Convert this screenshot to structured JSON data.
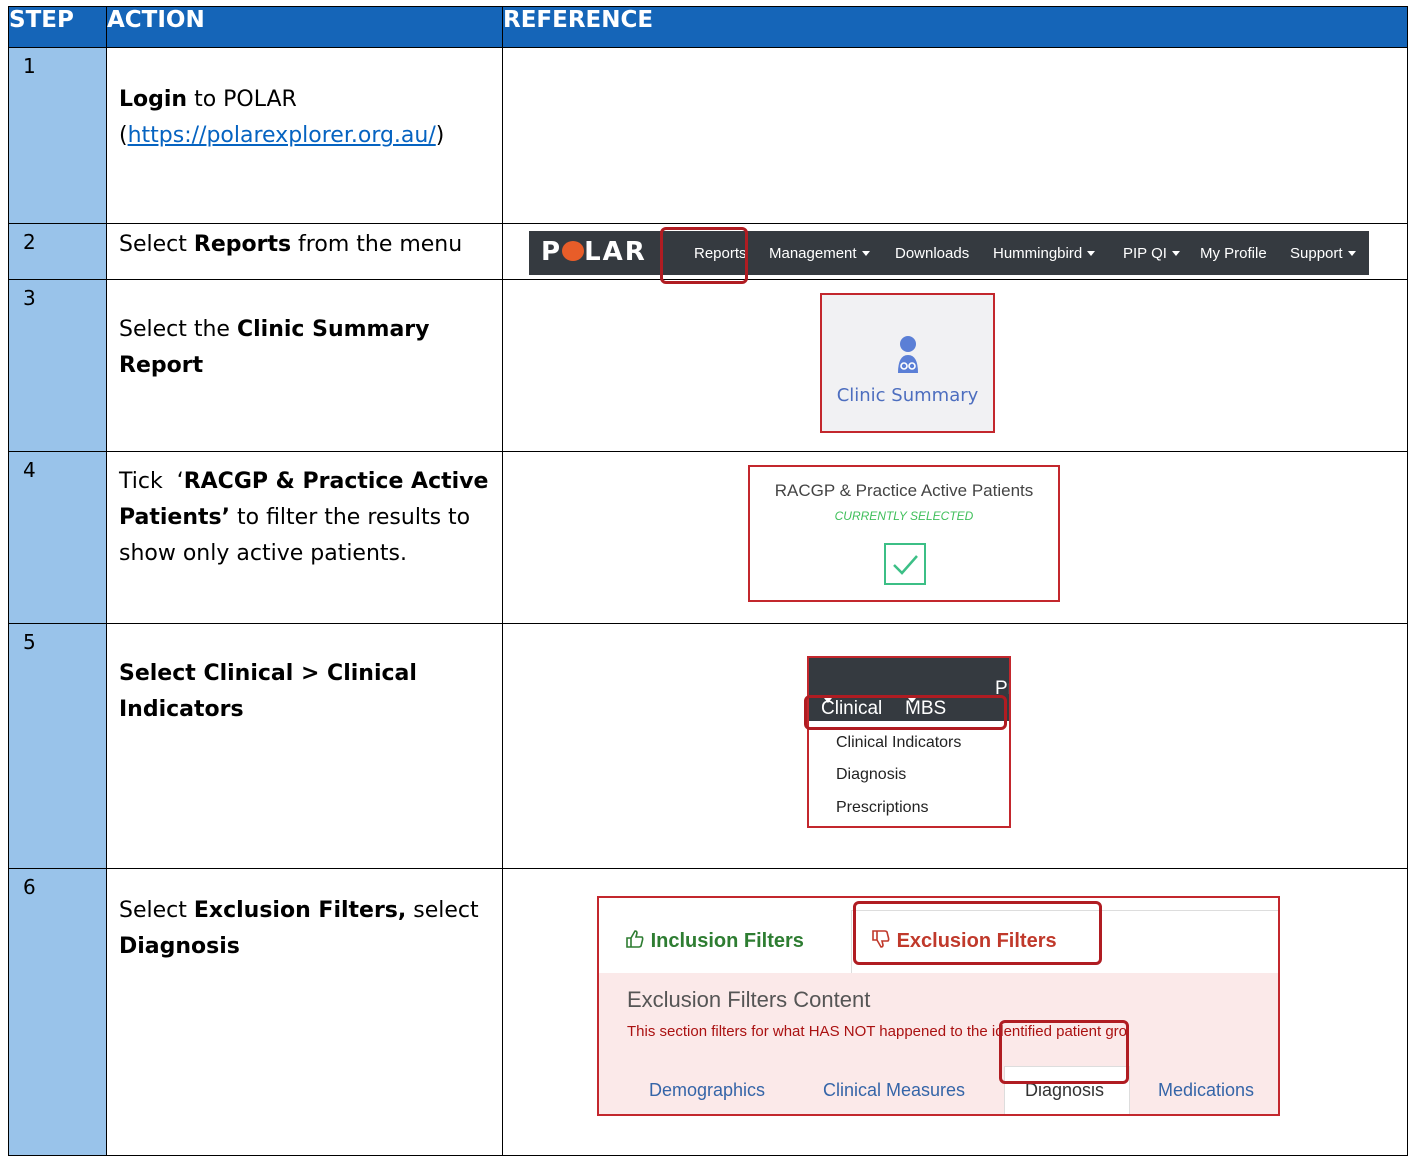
{
  "headers": {
    "step": "STEP",
    "action": "ACTION",
    "reference": "REFERENCE"
  },
  "rows": [
    {
      "step": "1",
      "action_bold": "Login",
      "action_text": " to POLAR",
      "action_link": "https://polarexplorer.org.au/"
    },
    {
      "step": "2",
      "action_pre": "Select ",
      "action_bold": "Reports",
      "action_post": " from the menu"
    },
    {
      "step": "3",
      "action_pre": "Select the ",
      "action_bold": "Clinic Summary Report"
    },
    {
      "step": "4",
      "action_pre": "Tick  ‘",
      "action_bold": "RACGP & Practice Active Patients’",
      "action_post": " to filter the results to show only active patients."
    },
    {
      "step": "5",
      "action_bold": "Select Clinical > Clinical Indicators"
    },
    {
      "step": "6",
      "action_pre": "Select ",
      "action_bold": "Exclusion Filters,",
      "action_mid": " select ",
      "action_bold2": "Diagnosis"
    }
  ],
  "navbar": {
    "logo": "POLAR",
    "items": [
      "Reports",
      "Management",
      "Downloads",
      "Hummingbird",
      "PIP QI",
      "My Profile",
      "Support"
    ]
  },
  "clinic_card": {
    "label": "Clinic Summary",
    "icon": "doctor-icon"
  },
  "racgp_card": {
    "title": "RACGP & Practice Active Patients",
    "status": "CURRENTLY SELECTED",
    "icon": "checkbox-checked-icon"
  },
  "clinical_menu": {
    "bar_items": [
      "Clinical",
      "MBS",
      "Pr"
    ],
    "items": [
      "Clinical Indicators",
      "Diagnosis",
      "Prescriptions"
    ]
  },
  "filters_panel": {
    "tab_inclusion": "Inclusion Filters",
    "tab_exclusion": "Exclusion Filters",
    "heading": "Exclusion Filters Content",
    "description": "This section filters for what HAS NOT happened to the identified patient gro",
    "subtabs": [
      "Demographics",
      "Clinical Measures",
      "Diagnosis",
      "Medications"
    ]
  },
  "colors": {
    "header": "#1565b8",
    "step_cell": "#99c3ea",
    "highlight": "#b01c22",
    "link": "#0563c1"
  }
}
